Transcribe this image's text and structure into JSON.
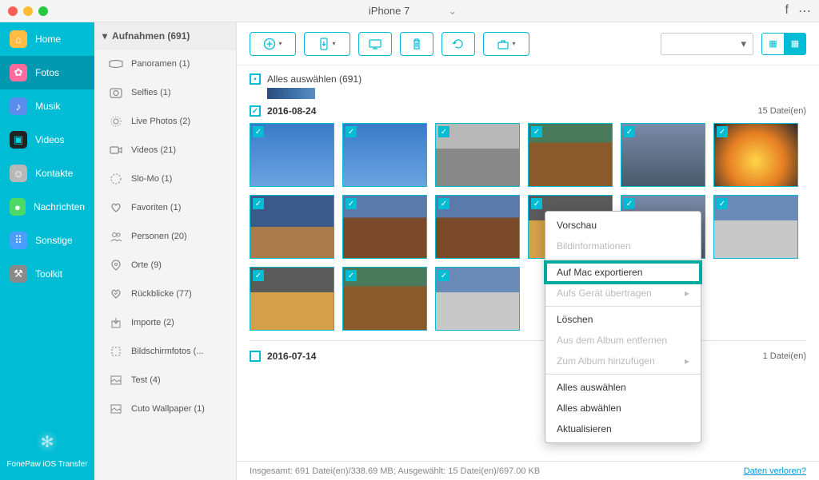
{
  "titlebar": {
    "device": "iPhone 7"
  },
  "sidebar": {
    "items": [
      {
        "label": "Home",
        "icon": "🏠",
        "bg": "#ffbc42"
      },
      {
        "label": "Fotos",
        "icon": "✿",
        "bg": "#ff6b9d"
      },
      {
        "label": "Musik",
        "icon": "♪",
        "bg": "#5b8def"
      },
      {
        "label": "Videos",
        "icon": "✦",
        "bg": "#00d4e0"
      },
      {
        "label": "Kontakte",
        "icon": "👤",
        "bg": "#b8b8b8"
      },
      {
        "label": "Nachrichten",
        "icon": "●",
        "bg": "#4cd964"
      },
      {
        "label": "Sonstige",
        "icon": "⠿",
        "bg": "#4a9eff"
      },
      {
        "label": "Toolkit",
        "icon": "⚒",
        "bg": "#8a8a8a"
      }
    ],
    "footer": "FonePaw iOS Transfer"
  },
  "panel2": {
    "header": "Aufnahmen (691)",
    "items": [
      {
        "label": "Panoramen (1)"
      },
      {
        "label": "Selfies (1)"
      },
      {
        "label": "Live Photos (2)"
      },
      {
        "label": "Videos (21)"
      },
      {
        "label": "Slo-Mo (1)"
      },
      {
        "label": "Favoriten (1)"
      },
      {
        "label": "Personen (20)"
      },
      {
        "label": "Orte (9)"
      },
      {
        "label": "Rückblicke (77)"
      },
      {
        "label": "Importe (2)"
      },
      {
        "label": "Bildschirmfotos (..."
      },
      {
        "label": "Test (4)"
      },
      {
        "label": "Cuto Wallpaper (1)"
      }
    ]
  },
  "content": {
    "selectAll": "Alles auswählen (691)",
    "groups": [
      {
        "date": "2016-08-24",
        "count": "15 Datei(en)",
        "checked": true
      },
      {
        "date": "2016-07-14",
        "count": "1 Datei(en)",
        "checked": false
      }
    ]
  },
  "context": {
    "preview": "Vorschau",
    "info": "Bildinformationen",
    "exportMac": "Auf Mac exportieren",
    "toDevice": "Aufs Gerät übertragen",
    "delete": "Löschen",
    "removeAlbum": "Aus dem Album entfernen",
    "addAlbum": "Zum Album hinzufügen",
    "selAll": "Alles auswählen",
    "deselAll": "Alles abwählen",
    "refresh": "Aktualisieren"
  },
  "status": {
    "text": "Insgesamt: 691 Datei(en)/338.69 MB; Ausgewählt: 15 Datei(en)/697.00 KB",
    "link": "Daten verloren?"
  }
}
